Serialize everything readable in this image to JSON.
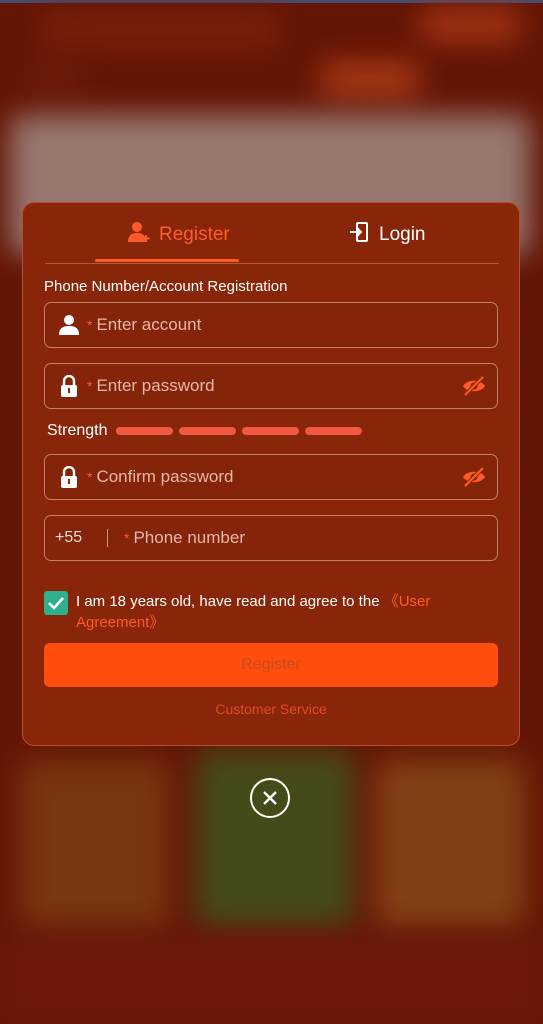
{
  "tabs": {
    "register": "Register",
    "login": "Login"
  },
  "form": {
    "section_title": "Phone Number/Account Registration",
    "required_mark": "*",
    "account_placeholder": "Enter account",
    "password_placeholder": "Enter password",
    "confirm_placeholder": "Confirm password",
    "phone_placeholder": "Phone number",
    "country_code": "+55",
    "strength_label": "Strength",
    "strength_bars": 4
  },
  "agreement": {
    "checked": true,
    "text": "I am 18 years old, have read and agree to the ",
    "link": "《User Agreement》"
  },
  "actions": {
    "register_button": "Register",
    "customer_service": "Customer Service"
  },
  "colors": {
    "accent": "#ff4d0d",
    "modal_bg": "#892609",
    "checkbox": "#2eb08f"
  },
  "icons": [
    "user-icon",
    "login-door-icon",
    "person-icon",
    "lock-icon",
    "eye-off-icon",
    "check-icon",
    "close-circle-icon"
  ]
}
